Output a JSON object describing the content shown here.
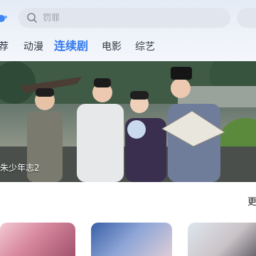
{
  "search": {
    "placeholder": "罚罪",
    "icon": "search-icon"
  },
  "tabs": [
    {
      "label": "荐",
      "active": false
    },
    {
      "label": "动漫",
      "active": false
    },
    {
      "label": "连续剧",
      "active": true
    },
    {
      "label": "电影",
      "active": false
    },
    {
      "label": "综艺",
      "active": false
    }
  ],
  "banner": {
    "title": "朱少年志2"
  },
  "section": {
    "more_label": "更"
  },
  "colors": {
    "accent": "#2f78f0",
    "search_bg": "#e1e6ee",
    "header_bg": "#e9eef7"
  }
}
